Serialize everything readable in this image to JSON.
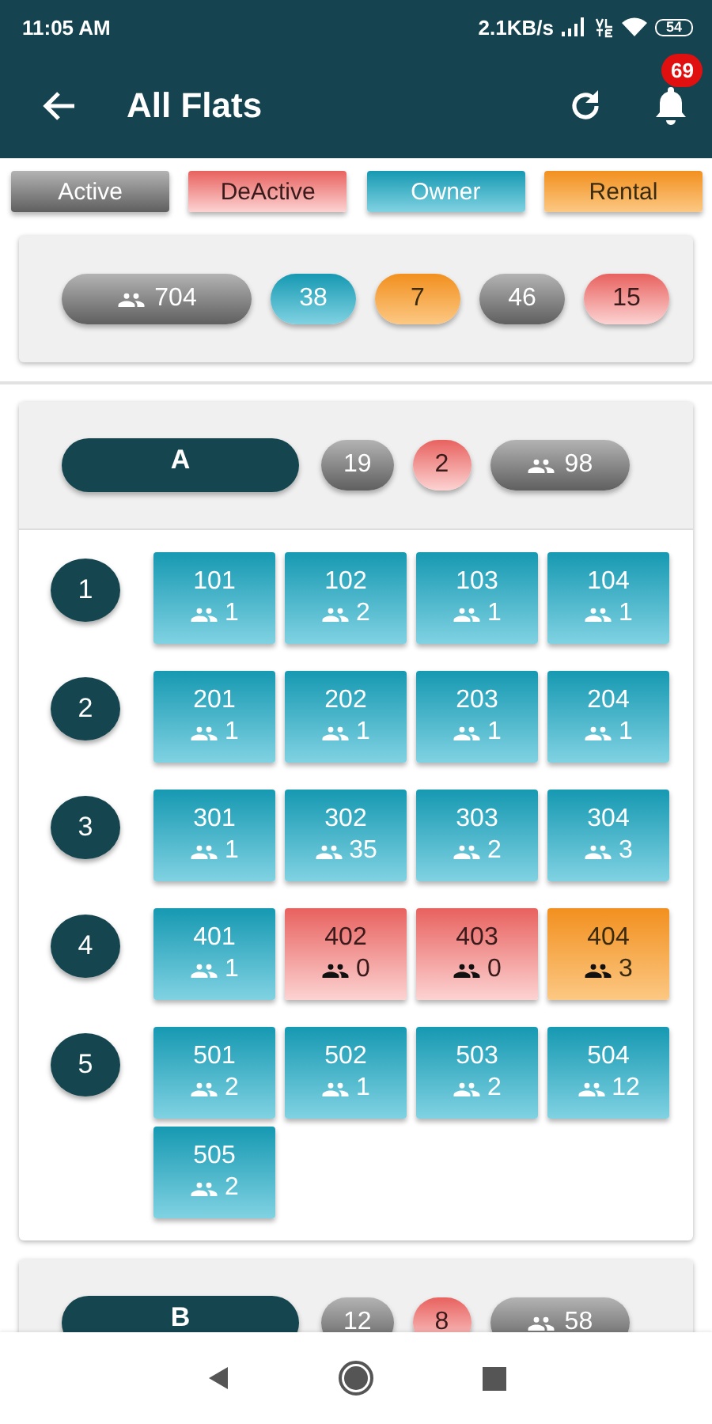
{
  "status_bar": {
    "time": "11:05 AM",
    "network_speed": "2.1KB/s",
    "battery": "54"
  },
  "app_bar": {
    "title": "All Flats",
    "notification_count": "69"
  },
  "legend": [
    {
      "label": "Active",
      "kind": "active"
    },
    {
      "label": "DeActive",
      "kind": "deactive"
    },
    {
      "label": "Owner",
      "kind": "owner"
    },
    {
      "label": "Rental",
      "kind": "rental"
    }
  ],
  "summary": {
    "members": "704",
    "counts": [
      {
        "value": "38",
        "kind": "owner"
      },
      {
        "value": "7",
        "kind": "rental"
      },
      {
        "value": "46",
        "kind": "active"
      },
      {
        "value": "15",
        "kind": "deactive"
      }
    ]
  },
  "blocks": [
    {
      "name": "A",
      "counts": [
        {
          "value": "19",
          "kind": "active"
        },
        {
          "value": "2",
          "kind": "deactive"
        }
      ],
      "members": "98",
      "floors": [
        {
          "number": "1",
          "flats": [
            {
              "number": "101",
              "members": "1",
              "kind": "owner"
            },
            {
              "number": "102",
              "members": "2",
              "kind": "owner"
            },
            {
              "number": "103",
              "members": "1",
              "kind": "owner"
            },
            {
              "number": "104",
              "members": "1",
              "kind": "owner"
            }
          ]
        },
        {
          "number": "2",
          "flats": [
            {
              "number": "201",
              "members": "1",
              "kind": "owner"
            },
            {
              "number": "202",
              "members": "1",
              "kind": "owner"
            },
            {
              "number": "203",
              "members": "1",
              "kind": "owner"
            },
            {
              "number": "204",
              "members": "1",
              "kind": "owner"
            }
          ]
        },
        {
          "number": "3",
          "flats": [
            {
              "number": "301",
              "members": "1",
              "kind": "owner"
            },
            {
              "number": "302",
              "members": "35",
              "kind": "owner"
            },
            {
              "number": "303",
              "members": "2",
              "kind": "owner"
            },
            {
              "number": "304",
              "members": "3",
              "kind": "owner"
            }
          ]
        },
        {
          "number": "4",
          "flats": [
            {
              "number": "401",
              "members": "1",
              "kind": "owner"
            },
            {
              "number": "402",
              "members": "0",
              "kind": "deactive"
            },
            {
              "number": "403",
              "members": "0",
              "kind": "deactive"
            },
            {
              "number": "404",
              "members": "3",
              "kind": "rental"
            }
          ]
        },
        {
          "number": "5",
          "flats": [
            {
              "number": "501",
              "members": "2",
              "kind": "owner"
            },
            {
              "number": "502",
              "members": "1",
              "kind": "owner"
            },
            {
              "number": "503",
              "members": "2",
              "kind": "owner"
            },
            {
              "number": "504",
              "members": "12",
              "kind": "owner"
            },
            {
              "number": "505",
              "members": "2",
              "kind": "owner"
            }
          ]
        }
      ]
    },
    {
      "name": "B",
      "counts": [
        {
          "value": "12",
          "kind": "active"
        },
        {
          "value": "8",
          "kind": "deactive"
        }
      ],
      "members": "58"
    }
  ]
}
